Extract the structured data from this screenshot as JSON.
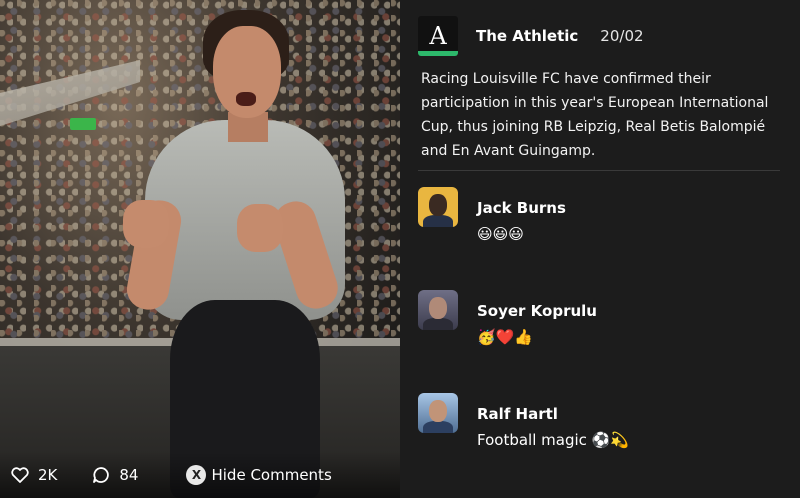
{
  "post": {
    "source": "The Athletic",
    "logo_letter": "A",
    "date": "20/02",
    "body": "Racing Louisville FC have confirmed their participation in this year's European International Cup, thus joining RB Leipzig, Real Betis Balompié and En Avant Guingamp."
  },
  "comments": [
    {
      "author": "Jack Burns",
      "text": "😃😃😃"
    },
    {
      "author": "Soyer Koprulu",
      "text": "🥳❤️👍"
    },
    {
      "author": "Ralf Hartl",
      "text": "Football magic ⚽💫"
    }
  ],
  "footer": {
    "likes": "2K",
    "comments": "84",
    "hide_button_key": "X",
    "hide_label": "Hide Comments"
  },
  "colors": {
    "panel_bg": "#1c1c1c",
    "logo_accent": "#2db86b",
    "avatar_1_bg": "#e9b640"
  }
}
